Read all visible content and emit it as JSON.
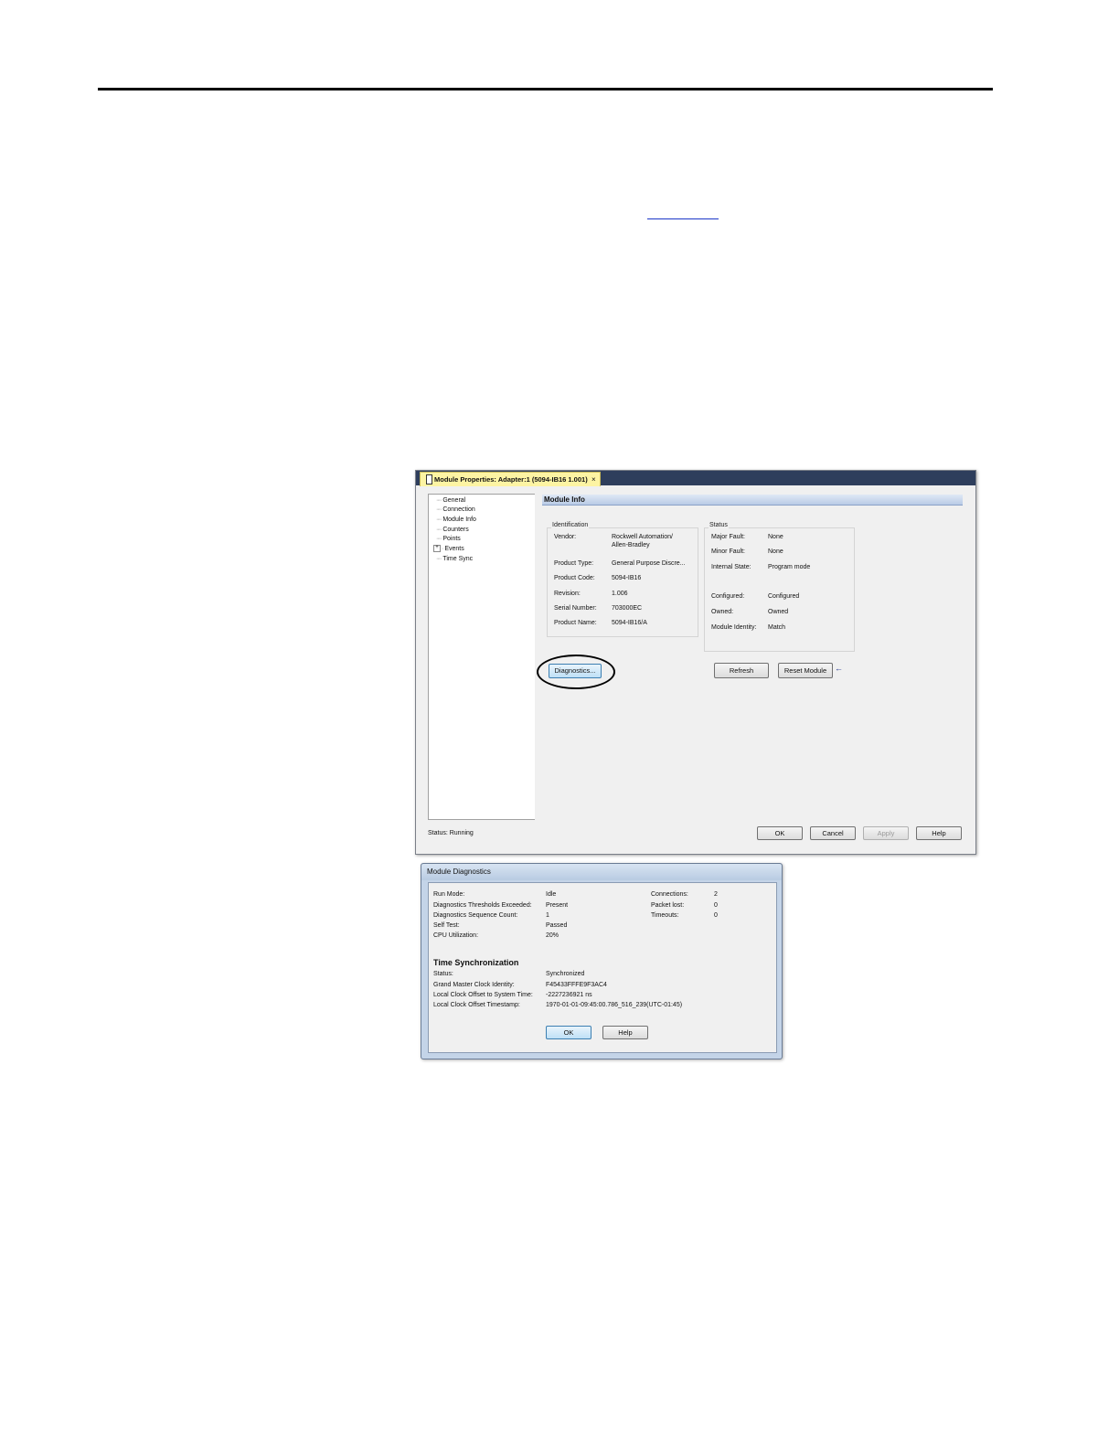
{
  "module_properties": {
    "tab_title": "Module Properties: Adapter:1 (5094-IB16 1.001)",
    "tab_close": "×",
    "tree": [
      {
        "label": "General"
      },
      {
        "label": "Connection"
      },
      {
        "label": "Module Info"
      },
      {
        "label": "Counters"
      },
      {
        "label": "Points"
      },
      {
        "label": "Events",
        "expandable": true
      },
      {
        "label": "Time Sync"
      }
    ],
    "section_title": "Module Info",
    "identification": {
      "group_label": "Identification",
      "vendor_label": "Vendor:",
      "vendor_value_1": "Rockwell Automation/",
      "vendor_value_2": "Allen-Bradley",
      "product_type_label": "Product Type:",
      "product_type_value": "General Purpose Discre...",
      "product_code_label": "Product Code:",
      "product_code_value": "5094-IB16",
      "revision_label": "Revision:",
      "revision_value": "1.006",
      "serial_label": "Serial Number:",
      "serial_value": "703000EC",
      "product_name_label": "Product Name:",
      "product_name_value": "5094-IB16/A"
    },
    "status_group": {
      "group_label": "Status",
      "major_fault_label": "Major Fault:",
      "major_fault_value": "None",
      "minor_fault_label": "Minor Fault:",
      "minor_fault_value": "None",
      "internal_state_label": "Internal State:",
      "internal_state_value": "Program mode",
      "configured_label": "Configured:",
      "configured_value": "Configured",
      "owned_label": "Owned:",
      "owned_value": "Owned",
      "identity_label": "Module Identity:",
      "identity_value": "Match"
    },
    "buttons": {
      "diagnostics": "Diagnostics...",
      "refresh": "Refresh",
      "reset_module": "Reset Module",
      "ok": "OK",
      "cancel": "Cancel",
      "apply": "Apply",
      "help": "Help"
    },
    "reset_arrow": "←",
    "status_bar": "Status:  Running"
  },
  "module_diagnostics": {
    "title": "Module Diagnostics",
    "rows": [
      {
        "label": "Run Mode:",
        "value": "Idle"
      },
      {
        "label": "Diagnostics Thresholds Exceeded:",
        "value": "Present"
      },
      {
        "label": "Diagnostics Sequence Count:",
        "value": "1"
      },
      {
        "label": "Self Test:",
        "value": "Passed"
      },
      {
        "label": "CPU Utilization:",
        "value": "20%"
      }
    ],
    "right_rows": [
      {
        "label": "Connections:",
        "value": "2"
      },
      {
        "label": "Packet lost:",
        "value": "0"
      },
      {
        "label": "Timeouts:",
        "value": "0"
      }
    ],
    "time_sync_heading": "Time Synchronization",
    "time_sync_rows": [
      {
        "label": "Status:",
        "value": "Synchronized"
      },
      {
        "label": "Grand Master Clock Identity:",
        "value": "F45433FFFE9F3AC4"
      },
      {
        "label": "Local Clock Offset to System Time:",
        "value": "-2227236921 ns"
      },
      {
        "label": "Local Clock Offset Timestamp:",
        "value": "1970-01-01-09:45:00.786_516_239(UTC-01:45)"
      }
    ],
    "buttons": {
      "ok": "OK",
      "help": "Help"
    }
  }
}
